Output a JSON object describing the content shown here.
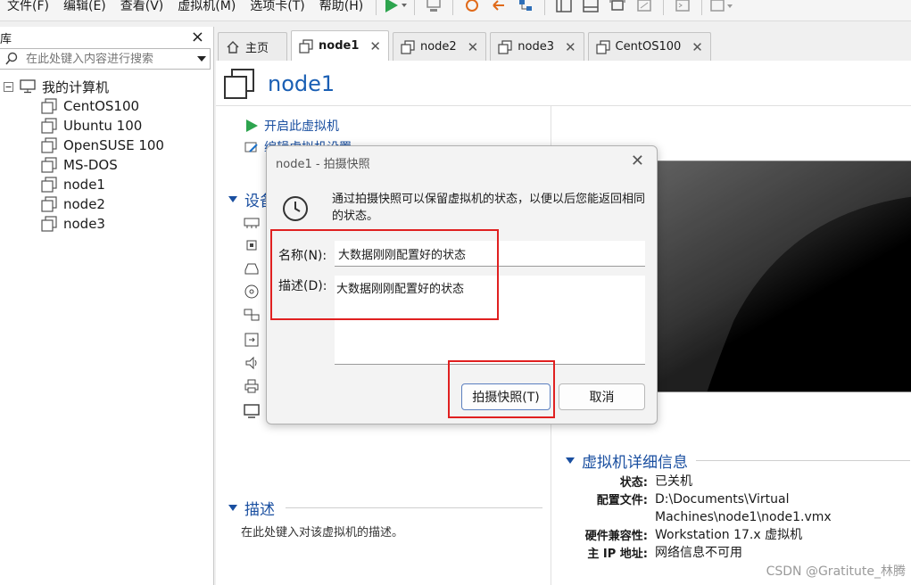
{
  "menu": {
    "file": "文件(F)",
    "edit": "编辑(E)",
    "view": "查看(V)",
    "vm": "虚拟机(M)",
    "tabs": "选项卡(T)",
    "help": "帮助(H)"
  },
  "library": {
    "title": "库",
    "search_placeholder": "在此处键入内容进行搜索",
    "root": "我的计算机",
    "items": [
      "CentOS100",
      "Ubuntu 100",
      "OpenSUSE 100",
      "MS-DOS",
      "node1",
      "node2",
      "node3"
    ]
  },
  "tabs": [
    {
      "label": "主页",
      "icon": "home-icon"
    },
    {
      "label": "node1",
      "icon": "vm-icon"
    },
    {
      "label": "node2",
      "icon": "vm-icon"
    },
    {
      "label": "node3",
      "icon": "vm-icon"
    },
    {
      "label": "CentOS100",
      "icon": "vm-icon"
    }
  ],
  "vm": {
    "title": "node1",
    "actions": {
      "power_on": "开启此虚拟机",
      "edit_settings": "编辑虚拟机设置"
    },
    "devices_header": "设备",
    "description_header": "描述",
    "description_hint": "在此处键入对该虚拟机的描述。",
    "details_header": "虚拟机详细信息",
    "details": [
      {
        "label": "状态:",
        "value": "已关机"
      },
      {
        "label": "配置文件:",
        "value": "D:\\Documents\\Virtual Machines\\node1\\node1.vmx"
      },
      {
        "label": "硬件兼容性:",
        "value": "Workstation 17.x 虚拟机"
      },
      {
        "label": "主 IP 地址:",
        "value": "网络信息不可用"
      }
    ]
  },
  "dialog": {
    "title": "node1 - 拍摄快照",
    "info": "通过拍摄快照可以保留虚拟机的状态，以便以后您能返回相同的状态。",
    "name_label": "名称(N):",
    "name_value": "大数据刚刚配置好的状态",
    "desc_label": "描述(D):",
    "desc_value": "大数据刚刚配置好的状态",
    "take_button": "拍摄快照(T)",
    "cancel_button": "取消"
  },
  "watermark": "CSDN @Gratitute_林腾",
  "colors": {
    "accent": "#1a5fb4",
    "play_green": "#2da44e",
    "highlight_red": "#e02020"
  }
}
